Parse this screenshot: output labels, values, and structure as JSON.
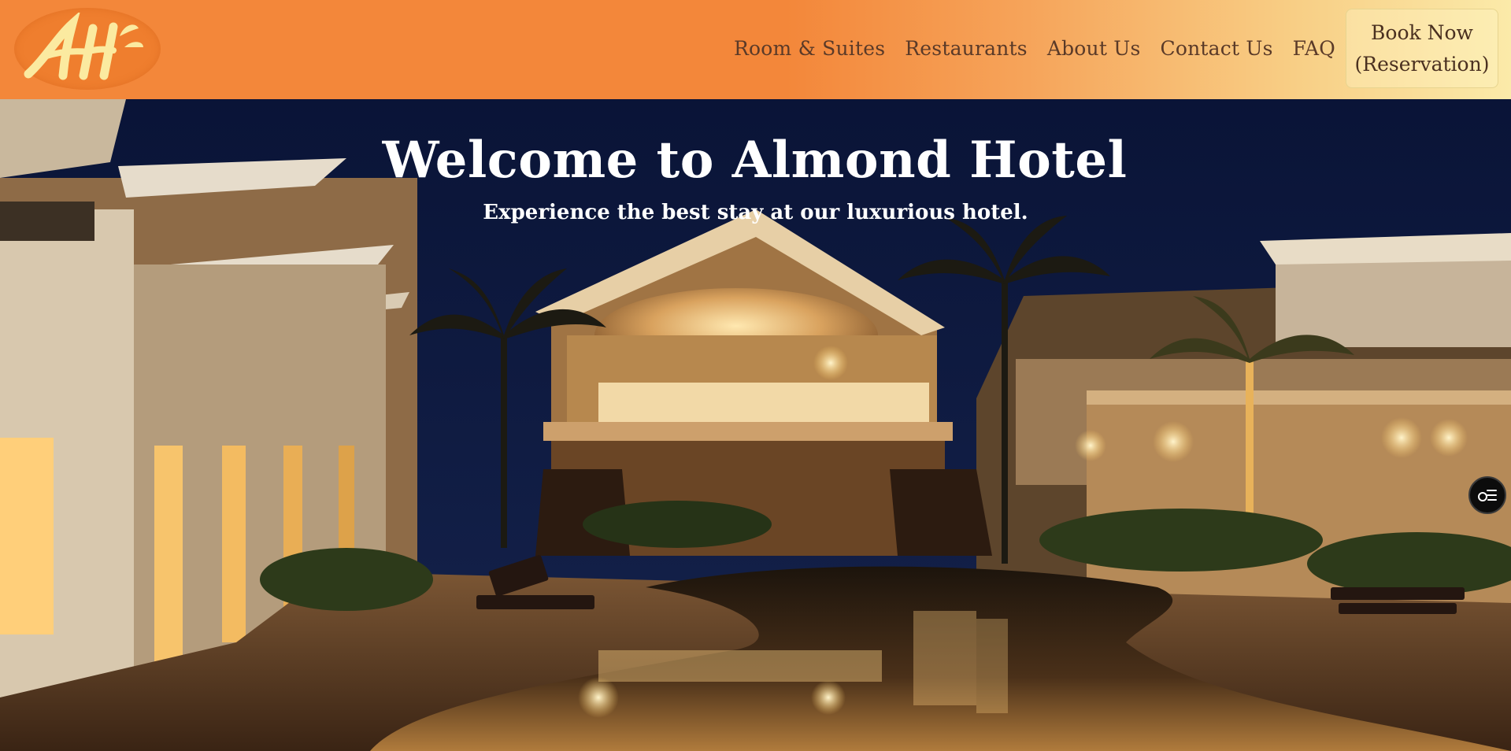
{
  "brand": {
    "logo_text": "AH",
    "logo_colors": {
      "badge": "#ef7e2e",
      "letters": "#fbeaa0"
    }
  },
  "nav": {
    "links": [
      {
        "label": "Room & Suites"
      },
      {
        "label": "Restaurants"
      },
      {
        "label": "About Us"
      },
      {
        "label": "Contact Us"
      },
      {
        "label": "FAQ"
      }
    ],
    "book_button": {
      "line1": "Book Now",
      "line2": "(Reservation)"
    }
  },
  "hero": {
    "title": "Welcome to Almond Hotel",
    "subtitle": "Experience the best stay at our luxurious hotel.",
    "image_description_icon": "hotel-pool-night-photo"
  },
  "widgets": {
    "side_toggle_icon": "accessibility-toggle-icon"
  },
  "colors": {
    "header_orange": "#f3873a",
    "header_cream": "#fbeaa9",
    "nav_text": "#5a3a28",
    "hero_text": "#ffffff"
  }
}
